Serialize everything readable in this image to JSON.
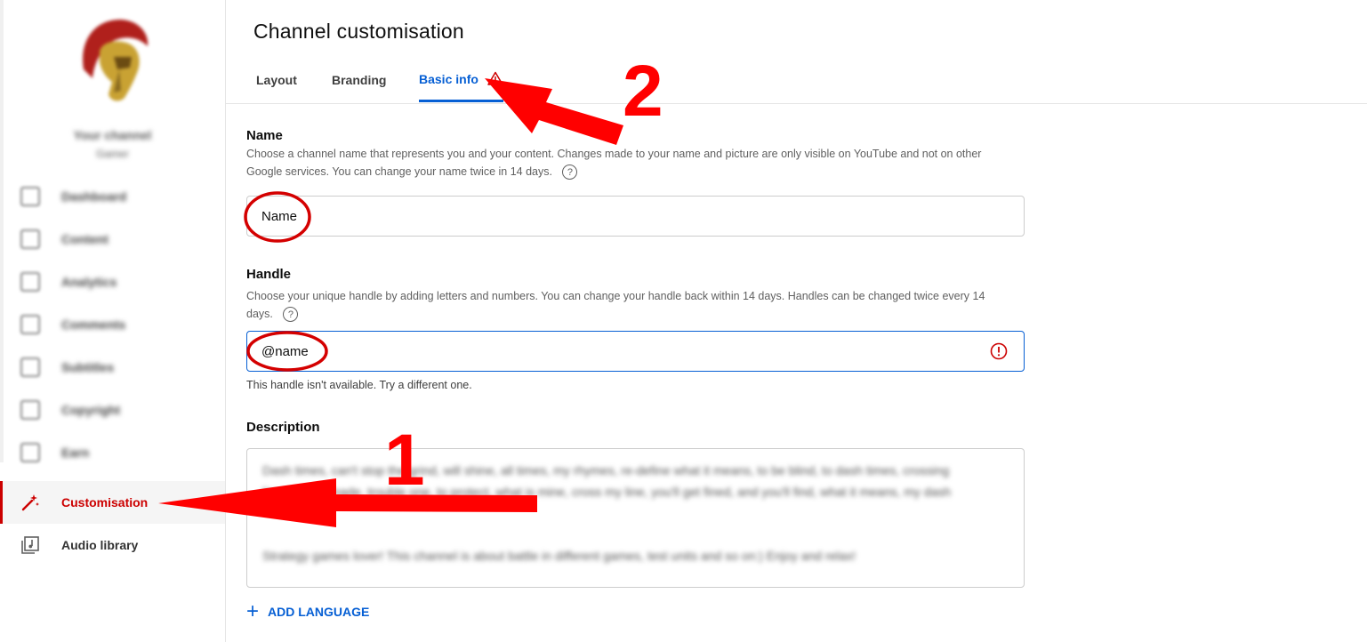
{
  "sidebar": {
    "channel_name": "Your channel",
    "channel_sub": "Gamer",
    "items": [
      {
        "label": "Dashboard",
        "icon": "dashboard-icon"
      },
      {
        "label": "Content",
        "icon": "content-icon"
      },
      {
        "label": "Analytics",
        "icon": "analytics-icon"
      },
      {
        "label": "Comments",
        "icon": "comments-icon"
      },
      {
        "label": "Subtitles",
        "icon": "subtitles-icon"
      },
      {
        "label": "Copyright",
        "icon": "copyright-icon"
      },
      {
        "label": "Earn",
        "icon": "earn-icon"
      },
      {
        "label": "Customisation",
        "icon": "magic-wand-icon"
      },
      {
        "label": "Audio library",
        "icon": "audio-library-icon"
      }
    ]
  },
  "main": {
    "title": "Channel customisation",
    "tabs": [
      {
        "label": "Layout"
      },
      {
        "label": "Branding"
      },
      {
        "label": "Basic info"
      }
    ],
    "name": {
      "label": "Name",
      "helper_line1": "Choose a channel name that represents you and your content. Changes made to your name and picture are only visible on YouTube and not on other",
      "helper_line2": "Google services. You can change your name twice in 14 days.",
      "value": "Name"
    },
    "handle": {
      "label": "Handle",
      "helper_line1": "Choose your unique handle by adding letters and numbers. You can change your handle back within 14 days. Handles can be changed twice every 14",
      "helper_line2": "days.",
      "value": "@name",
      "error": "This handle isn't available. Try a different one."
    },
    "description": {
      "label": "Description",
      "line1": "Dash times, can't stop the grind, will shine, all times, my rhymes, re-define what it means, to be blind, to dash times, crossing",
      "line2": "lines, never made, trouble one, to protect, what is mine, cross my line, you'll get fined, and you'll find, what it means, my dash",
      "line3": "Strategy games lover! This channel is about battle in different games, test units and so on:) Enjoy and relax!"
    },
    "add_language": "ADD LANGUAGE"
  },
  "annotations": {
    "label_1": "1",
    "label_2": "2"
  },
  "colors": {
    "accent_blue": "#065fd4",
    "active_red": "#cc0000",
    "annotation_red": "#ff0000",
    "error_red": "#cc0000"
  }
}
